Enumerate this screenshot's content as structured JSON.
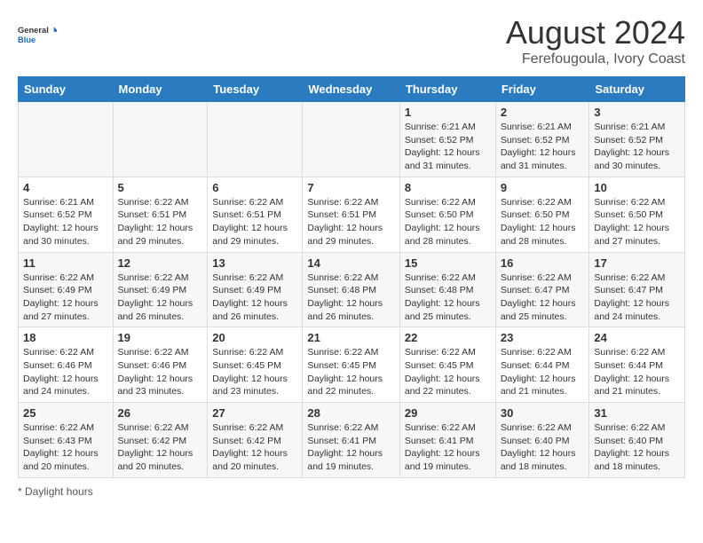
{
  "header": {
    "logo_general": "General",
    "logo_blue": "Blue",
    "main_title": "August 2024",
    "subtitle": "Ferefougoula, Ivory Coast"
  },
  "calendar": {
    "days_of_week": [
      "Sunday",
      "Monday",
      "Tuesday",
      "Wednesday",
      "Thursday",
      "Friday",
      "Saturday"
    ],
    "weeks": [
      [
        {
          "day": "",
          "info": ""
        },
        {
          "day": "",
          "info": ""
        },
        {
          "day": "",
          "info": ""
        },
        {
          "day": "",
          "info": ""
        },
        {
          "day": "1",
          "info": "Sunrise: 6:21 AM\nSunset: 6:52 PM\nDaylight: 12 hours and 31 minutes."
        },
        {
          "day": "2",
          "info": "Sunrise: 6:21 AM\nSunset: 6:52 PM\nDaylight: 12 hours and 31 minutes."
        },
        {
          "day": "3",
          "info": "Sunrise: 6:21 AM\nSunset: 6:52 PM\nDaylight: 12 hours and 30 minutes."
        }
      ],
      [
        {
          "day": "4",
          "info": "Sunrise: 6:21 AM\nSunset: 6:52 PM\nDaylight: 12 hours and 30 minutes."
        },
        {
          "day": "5",
          "info": "Sunrise: 6:22 AM\nSunset: 6:51 PM\nDaylight: 12 hours and 29 minutes."
        },
        {
          "day": "6",
          "info": "Sunrise: 6:22 AM\nSunset: 6:51 PM\nDaylight: 12 hours and 29 minutes."
        },
        {
          "day": "7",
          "info": "Sunrise: 6:22 AM\nSunset: 6:51 PM\nDaylight: 12 hours and 29 minutes."
        },
        {
          "day": "8",
          "info": "Sunrise: 6:22 AM\nSunset: 6:50 PM\nDaylight: 12 hours and 28 minutes."
        },
        {
          "day": "9",
          "info": "Sunrise: 6:22 AM\nSunset: 6:50 PM\nDaylight: 12 hours and 28 minutes."
        },
        {
          "day": "10",
          "info": "Sunrise: 6:22 AM\nSunset: 6:50 PM\nDaylight: 12 hours and 27 minutes."
        }
      ],
      [
        {
          "day": "11",
          "info": "Sunrise: 6:22 AM\nSunset: 6:49 PM\nDaylight: 12 hours and 27 minutes."
        },
        {
          "day": "12",
          "info": "Sunrise: 6:22 AM\nSunset: 6:49 PM\nDaylight: 12 hours and 26 minutes."
        },
        {
          "day": "13",
          "info": "Sunrise: 6:22 AM\nSunset: 6:49 PM\nDaylight: 12 hours and 26 minutes."
        },
        {
          "day": "14",
          "info": "Sunrise: 6:22 AM\nSunset: 6:48 PM\nDaylight: 12 hours and 26 minutes."
        },
        {
          "day": "15",
          "info": "Sunrise: 6:22 AM\nSunset: 6:48 PM\nDaylight: 12 hours and 25 minutes."
        },
        {
          "day": "16",
          "info": "Sunrise: 6:22 AM\nSunset: 6:47 PM\nDaylight: 12 hours and 25 minutes."
        },
        {
          "day": "17",
          "info": "Sunrise: 6:22 AM\nSunset: 6:47 PM\nDaylight: 12 hours and 24 minutes."
        }
      ],
      [
        {
          "day": "18",
          "info": "Sunrise: 6:22 AM\nSunset: 6:46 PM\nDaylight: 12 hours and 24 minutes."
        },
        {
          "day": "19",
          "info": "Sunrise: 6:22 AM\nSunset: 6:46 PM\nDaylight: 12 hours and 23 minutes."
        },
        {
          "day": "20",
          "info": "Sunrise: 6:22 AM\nSunset: 6:45 PM\nDaylight: 12 hours and 23 minutes."
        },
        {
          "day": "21",
          "info": "Sunrise: 6:22 AM\nSunset: 6:45 PM\nDaylight: 12 hours and 22 minutes."
        },
        {
          "day": "22",
          "info": "Sunrise: 6:22 AM\nSunset: 6:45 PM\nDaylight: 12 hours and 22 minutes."
        },
        {
          "day": "23",
          "info": "Sunrise: 6:22 AM\nSunset: 6:44 PM\nDaylight: 12 hours and 21 minutes."
        },
        {
          "day": "24",
          "info": "Sunrise: 6:22 AM\nSunset: 6:44 PM\nDaylight: 12 hours and 21 minutes."
        }
      ],
      [
        {
          "day": "25",
          "info": "Sunrise: 6:22 AM\nSunset: 6:43 PM\nDaylight: 12 hours and 20 minutes."
        },
        {
          "day": "26",
          "info": "Sunrise: 6:22 AM\nSunset: 6:42 PM\nDaylight: 12 hours and 20 minutes."
        },
        {
          "day": "27",
          "info": "Sunrise: 6:22 AM\nSunset: 6:42 PM\nDaylight: 12 hours and 20 minutes."
        },
        {
          "day": "28",
          "info": "Sunrise: 6:22 AM\nSunset: 6:41 PM\nDaylight: 12 hours and 19 minutes."
        },
        {
          "day": "29",
          "info": "Sunrise: 6:22 AM\nSunset: 6:41 PM\nDaylight: 12 hours and 19 minutes."
        },
        {
          "day": "30",
          "info": "Sunrise: 6:22 AM\nSunset: 6:40 PM\nDaylight: 12 hours and 18 minutes."
        },
        {
          "day": "31",
          "info": "Sunrise: 6:22 AM\nSunset: 6:40 PM\nDaylight: 12 hours and 18 minutes."
        }
      ]
    ]
  },
  "footer": {
    "note": "Daylight hours"
  }
}
